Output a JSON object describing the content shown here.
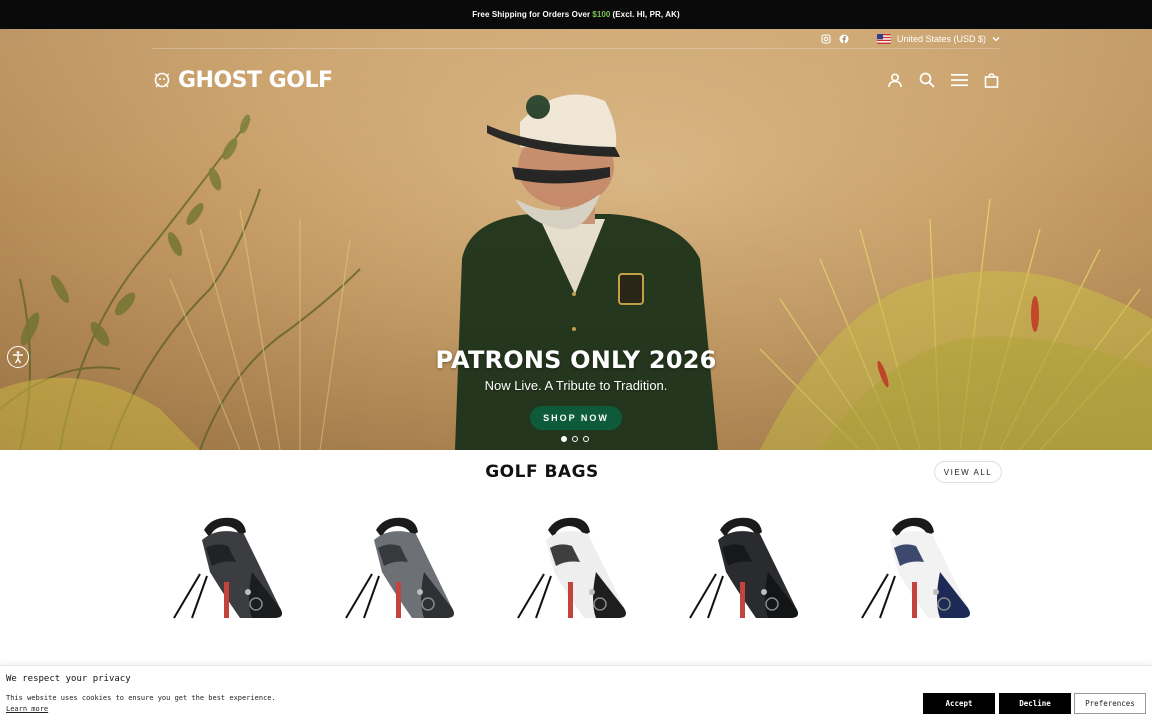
{
  "announcement": {
    "text_before": "Free Shipping for Orders Over",
    "price": "$100",
    "text_after": "(Excl. HI, PR, AK)",
    "price_color": "#7ec35a"
  },
  "header": {
    "logo_text": "GHOST GOLF",
    "country_selector": "United States (USD $)",
    "social": [
      "instagram-icon",
      "facebook-icon"
    ],
    "nav_icons": [
      "account-icon",
      "search-icon",
      "menu-icon",
      "cart-icon"
    ]
  },
  "hero": {
    "title": "PATRONS ONLY 2026",
    "subtitle": "Now Live. A Tribute to Tradition.",
    "cta_label": "SHOP NOW",
    "cta_color": "#0d5b3a",
    "slides_total": 3,
    "active_slide": 1
  },
  "golf_bags": {
    "title": "GOLF BAGS",
    "view_all_label": "VIEW ALL",
    "products": [
      {
        "colorway": "charcoal",
        "body": "#3b3d40",
        "panel": "#1c1d1f",
        "accent": "#c2443c"
      },
      {
        "colorway": "grey",
        "body": "#6d7176",
        "panel": "#2e3033",
        "accent": "#c2443c"
      },
      {
        "colorway": "white",
        "body": "#eeeeee",
        "panel": "#1e1e1e",
        "accent": "#c2443c"
      },
      {
        "colorway": "black",
        "body": "#2a2b2e",
        "panel": "#141516",
        "accent": "#c2443c"
      },
      {
        "colorway": "white-navy",
        "body": "#f2f2f2",
        "panel": "#1c2a55",
        "accent": "#c2443c"
      }
    ]
  },
  "cookie_banner": {
    "title": "We respect your privacy",
    "text": "This website uses cookies to ensure you get the best experience.",
    "link": "Learn more",
    "accept": "Accept",
    "decline": "Decline",
    "preferences": "Preferences"
  }
}
